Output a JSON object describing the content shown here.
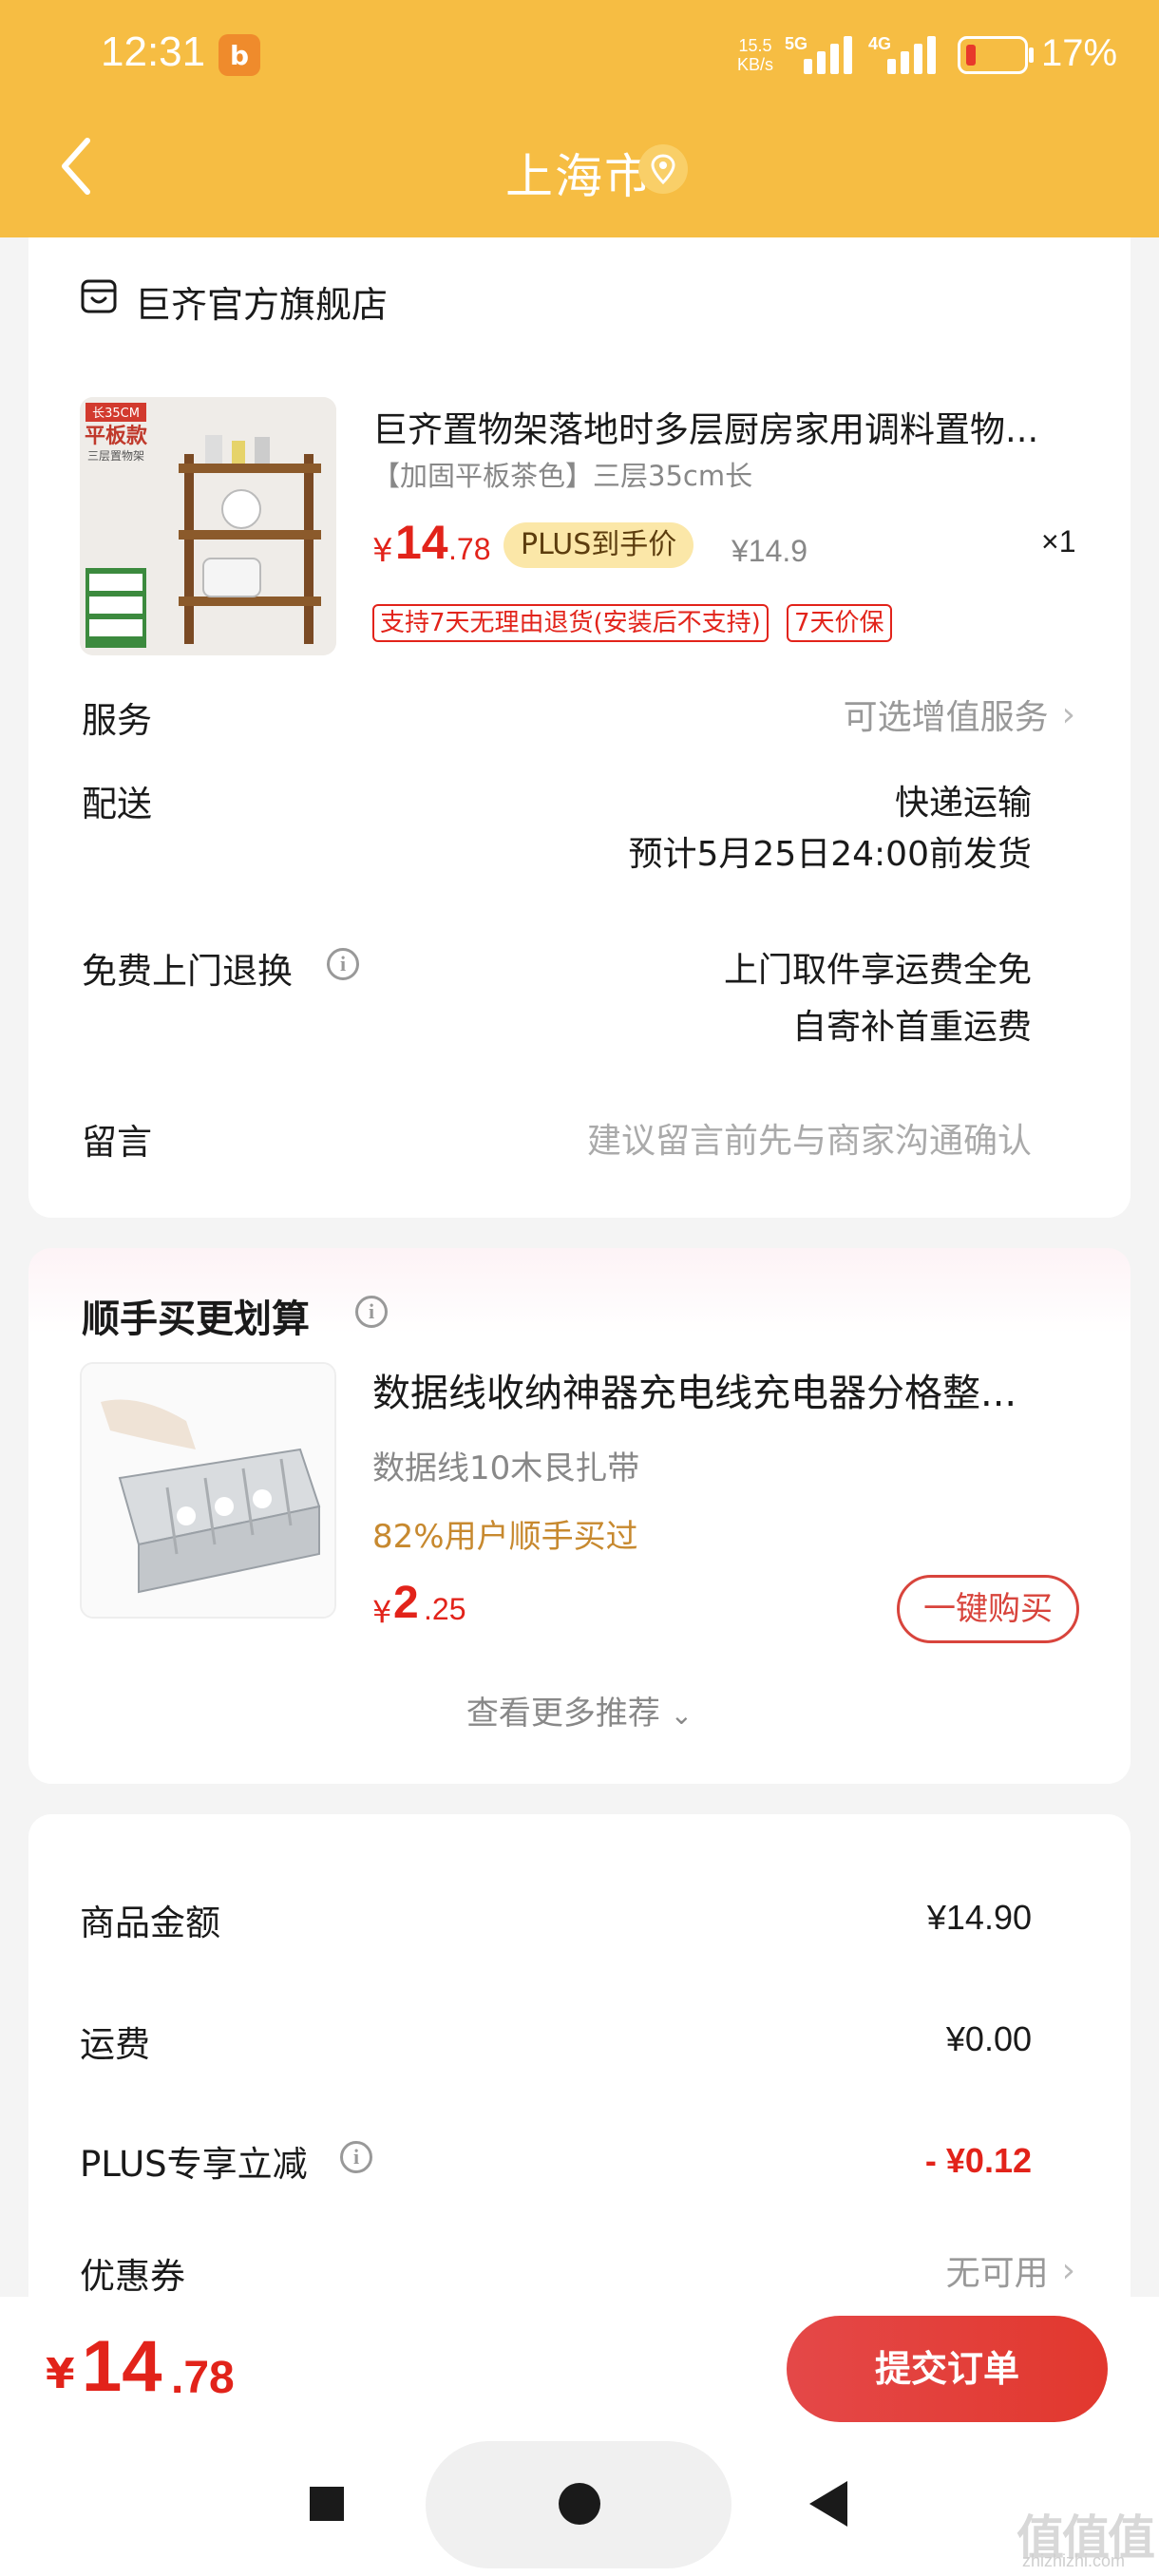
{
  "status_bar": {
    "time": "12:31",
    "app_icon_glyph": "b",
    "net_speed_value": "15.5",
    "net_speed_unit": "KB/s",
    "signal1_label": "5G",
    "signal2_label": "4G",
    "battery_percent": "17%",
    "battery_level": 0.17
  },
  "nav": {
    "title": "上海市"
  },
  "order_card": {
    "shop_name": "巨齐官方旗舰店",
    "product": {
      "image_label_top": "长35CM",
      "image_label_main": "平板款",
      "image_label_sub": "三层置物架",
      "title": "巨齐置物架落地时多层厨房家用调料置物...",
      "spec": "【加固平板茶色】三层35cm长",
      "price_symbol": "¥",
      "price_int": "14",
      "price_dec": ".78",
      "plus_badge": "PLUS到手价",
      "original_price": "¥14.9",
      "quantity": "×1",
      "tags": [
        "支持7天无理由退货(安装后不支持)",
        "7天价保"
      ]
    },
    "rows": {
      "service_label": "服务",
      "service_value": "可选增值服务",
      "delivery_label": "配送",
      "delivery_method": "快递运输",
      "delivery_eta": "预计5月25日24:00前发货",
      "return_label": "免费上门退换",
      "return_line1": "上门取件享运费全免",
      "return_line2": "自寄补首重运费",
      "message_label": "留言",
      "message_placeholder": "建议留言前先与商家沟通确认"
    }
  },
  "recommend_card": {
    "title": "顺手买更划算",
    "item": {
      "title": "数据线收纳神器充电线充电器分格整...",
      "spec": "数据线10木艮扎带",
      "popularity": "82%用户顺手买过",
      "price_symbol": "¥",
      "price_int": "2",
      "price_dec": ".25",
      "buy_button": "一键购买"
    },
    "more_link": "查看更多推荐"
  },
  "summary_card": {
    "rows": [
      {
        "label": "商品金额",
        "value": "¥14.90"
      },
      {
        "label": "运费",
        "value": "¥0.00"
      },
      {
        "label": "PLUS专享立减",
        "value": "- ¥0.12"
      },
      {
        "label": "优惠券",
        "value": "无可用"
      }
    ]
  },
  "bottom_bar": {
    "total_symbol": "¥",
    "total_int": "14",
    "total_dec": ".78",
    "submit_label": "提交订单"
  },
  "watermark": {
    "text": "值值值",
    "sub": "zhizhizhi.com"
  },
  "colors": {
    "header": "#f6bd43",
    "price_red": "#e2231a",
    "plus_gold": "#fbe7a8",
    "popularity_orange": "#c7892f",
    "submit_red": "#e2382e"
  },
  "icons": [
    "back-arrow-icon",
    "location-icon",
    "shop-icon",
    "info-icon",
    "chevron-right-icon",
    "chevron-down-icon",
    "stop-square-icon",
    "home-circle-icon",
    "back-triangle-icon"
  ]
}
